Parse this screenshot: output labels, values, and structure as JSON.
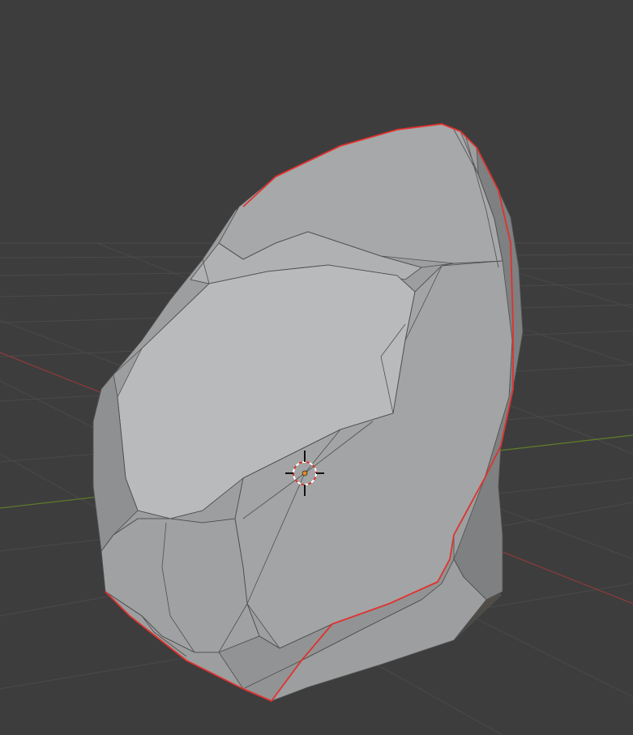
{
  "viewport": {
    "background_color": "#3d3d3d",
    "grid_color": "#4a4a4a",
    "x_axis_color": "#8a3a3a",
    "y_axis_color": "#5d7a2a",
    "selection_outline_color": "#e0322e",
    "mesh_face_color": "#a8a9aa",
    "mesh_edge_color": "#505050",
    "origin_dot_color": "#e08a1e",
    "cursor_icon": "3d-cursor-icon"
  }
}
